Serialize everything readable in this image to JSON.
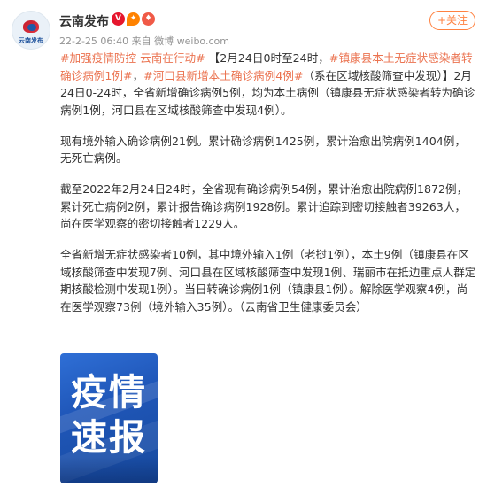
{
  "header": {
    "avatar_text": "云南发布",
    "account_name": "云南发布",
    "badge_icons": [
      "verified-badge-icon",
      "vip-icon",
      "fire-icon"
    ],
    "meta": "22-2-25 06:40 来自 微博 weibo.com",
    "follow_label": "+关注"
  },
  "post": {
    "p1": {
      "tag1": "#加强疫情防控 云南在行动#",
      "t1": " 【2月24日0时至24时，",
      "tag2": "#镇康县本土无症状感染者转确诊病例1例#",
      "t2": "，",
      "tag3": "#河口县新增本土确诊病例4例#",
      "t3": "（系在区域核酸筛查中发现）】2月24日0-24时，全省新增确诊病例5例，均为本土病例（镇康县无症状感染者转为确诊病例1例，河口县在区域核酸筛查中发现4例）。"
    },
    "p2": "现有境外输入确诊病例21例。累计确诊病例1425例，累计治愈出院病例1404例，无死亡病例。",
    "p3": "截至2022年2月24日24时，全省现有确诊病例54例，累计治愈出院病例1872例，累计死亡病例2例，累计报告确诊病例1928例。累计追踪到密切接触者39263人，尚在医学观察的密切接触者1229人。",
    "p4": "全省新增无症状感染者10例，其中境外输入1例（老挝1例），本土9例（镇康县在区域核酸筛查中发现7例、河口县在区域核酸筛查中发现1例、瑞丽市在抵边重点人群定期核酸检测中发现1例）。当日转确诊病例1例（镇康县1例）。解除医学观察4例，尚在医学观察73例（境外输入35例）。（云南省卫生健康委员会）"
  },
  "image_card": {
    "line1": "疫情",
    "line2": "速报"
  },
  "colors": {
    "hashtag": "#eb7350",
    "follow": "#ff8140",
    "card_bg": "#2f6fd6"
  }
}
